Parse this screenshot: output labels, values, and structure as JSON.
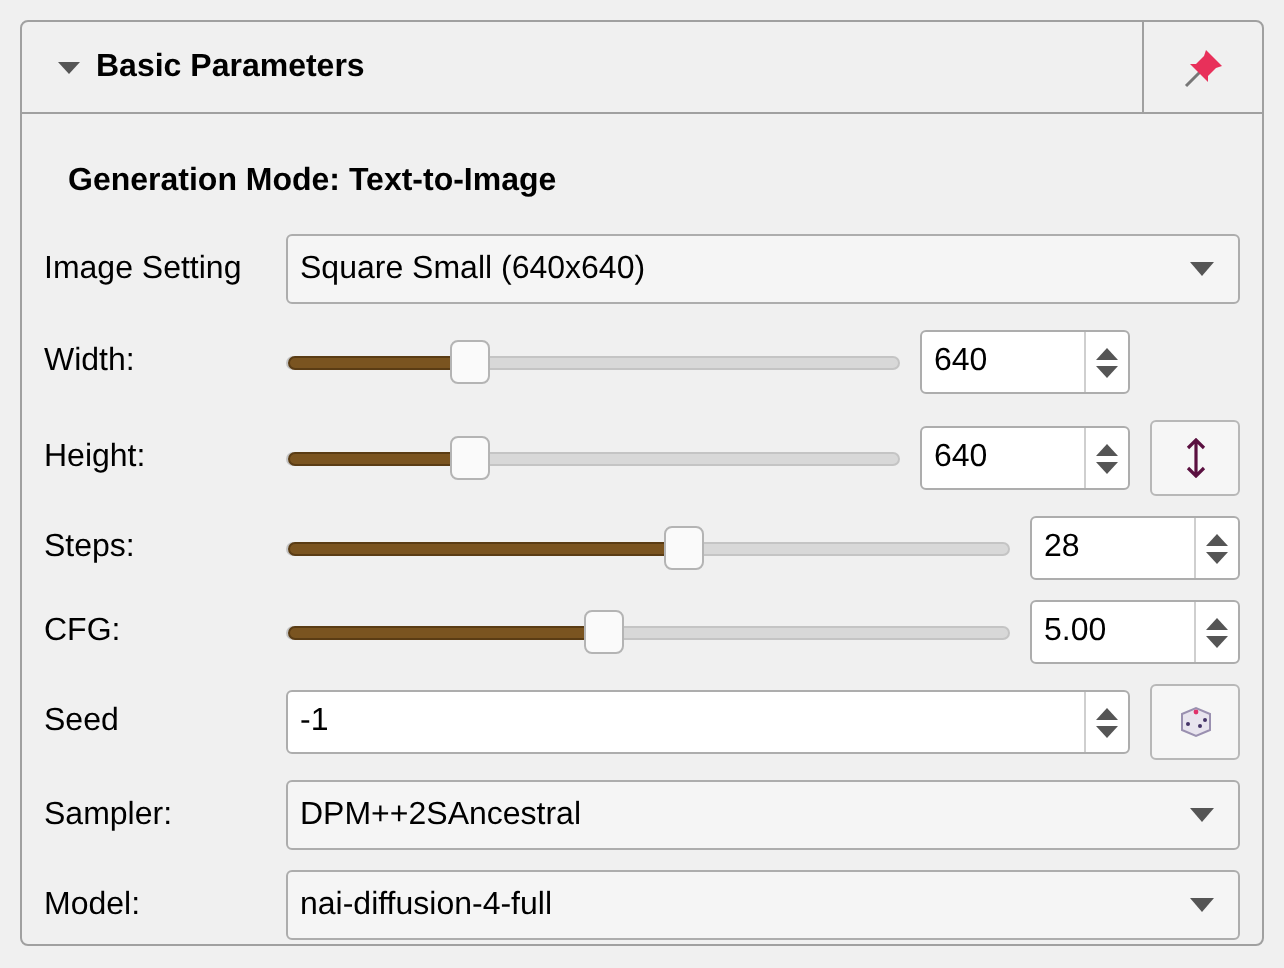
{
  "panel": {
    "title": "Basic Parameters",
    "expanded": true,
    "mode_label": "Generation Mode: Text-to-Image"
  },
  "fields": [
    {
      "kind": "dropdown",
      "label": "Image Setting",
      "value": "Square Small (640x640)"
    },
    {
      "kind": "dimension",
      "label": "Width:",
      "level": 0.3,
      "value": "640"
    },
    {
      "kind": "dimension",
      "label": "Height:",
      "level": 0.3,
      "value": "640",
      "button": {
        "kind": "swap"
      }
    },
    {
      "kind": "slider",
      "label": "Steps:",
      "level": 0.55,
      "value": "28"
    },
    {
      "kind": "slider",
      "label": "CFG:",
      "level": 0.44,
      "value": "5.00"
    },
    {
      "kind": "number",
      "label": "Seed",
      "value": "-1",
      "button": {
        "kind": "dice"
      }
    },
    {
      "kind": "dropdown",
      "label": "Sampler:",
      "value": "DPM++2SAncestral"
    },
    {
      "kind": "dropdown",
      "label": "Model:",
      "value": "nai-diffusion-4-full"
    }
  ]
}
